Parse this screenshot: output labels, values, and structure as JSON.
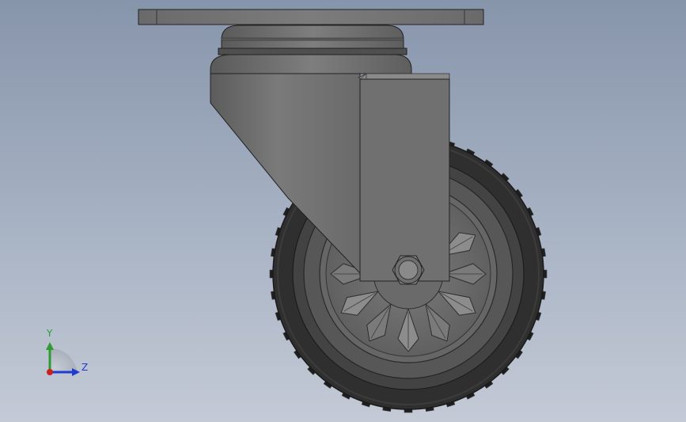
{
  "viewport": {
    "background_top": "#8795ab",
    "background_bottom": "#c4cad6",
    "model_color": "#6e6e6e",
    "tire_color": "#303030"
  },
  "triad": {
    "y_label": "Y",
    "z_label": "Z",
    "y_color": "#2e9a32",
    "z_color": "#1f3bd0",
    "x_color": "#cc2020"
  }
}
